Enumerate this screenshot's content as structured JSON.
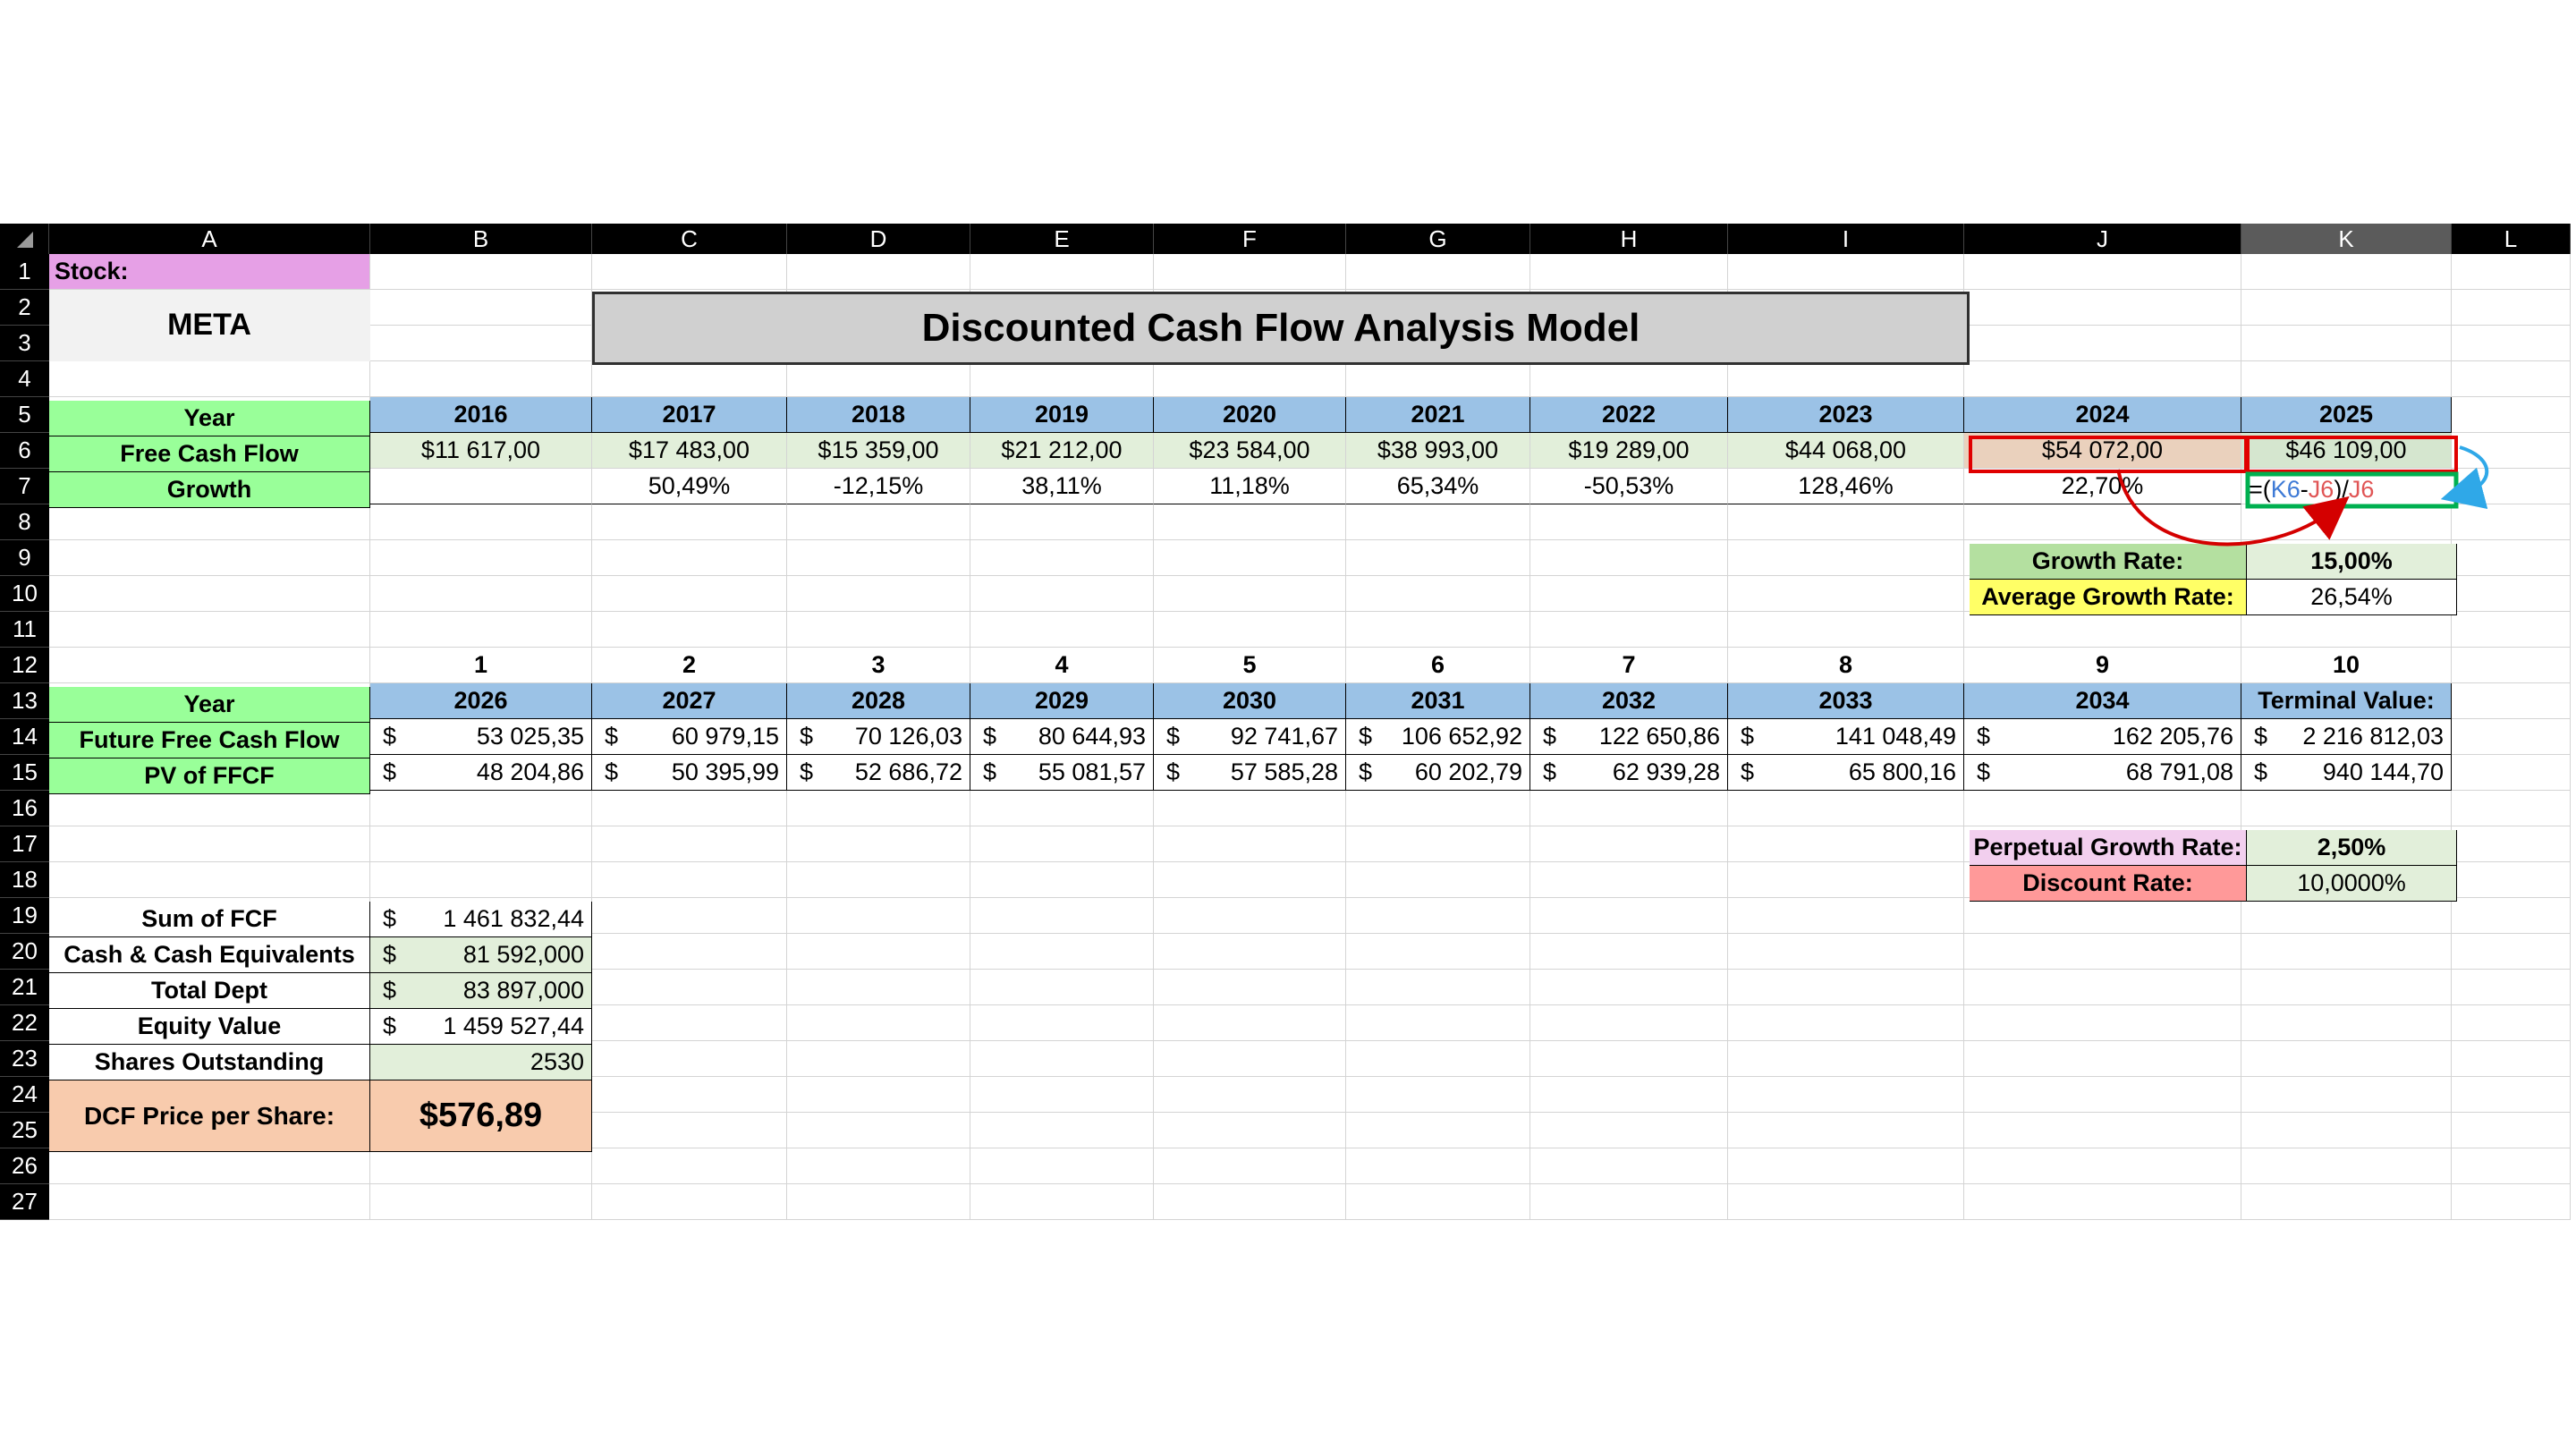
{
  "sheet": {
    "columns": [
      "A",
      "B",
      "C",
      "D",
      "E",
      "F",
      "G",
      "H",
      "I",
      "J",
      "K",
      "L"
    ],
    "selected_column": "K",
    "rows": [
      "1",
      "2",
      "3",
      "4",
      "5",
      "6",
      "7",
      "8",
      "9",
      "10",
      "11",
      "12",
      "13",
      "14",
      "15",
      "16",
      "17",
      "18",
      "19",
      "20",
      "21",
      "22",
      "23",
      "24",
      "25",
      "26",
      "27"
    ]
  },
  "stock": {
    "label": "Stock:",
    "ticker": "META"
  },
  "title": "Discounted Cash Flow Analysis Model",
  "historical": {
    "year_label": "Year",
    "years": [
      "2016",
      "2017",
      "2018",
      "2019",
      "2020",
      "2021",
      "2022",
      "2023",
      "2024",
      "2025"
    ],
    "fcf_label": "Free Cash Flow",
    "fcf": [
      "$11 617,00",
      "$17 483,00",
      "$15 359,00",
      "$21 212,00",
      "$23 584,00",
      "$38 993,00",
      "$19 289,00",
      "$44 068,00",
      "$54 072,00",
      "$46 109,00"
    ],
    "growth_label": "Growth",
    "growth": [
      "",
      "50,49%",
      "-12,15%",
      "38,11%",
      "11,18%",
      "65,34%",
      "-50,53%",
      "128,46%",
      "22,70%",
      ""
    ],
    "formula_parts": [
      "=(",
      "K6",
      "-",
      "J6",
      ")/",
      "J6"
    ]
  },
  "rates": {
    "growth_rate_label": "Growth Rate:",
    "growth_rate": "15,00%",
    "avg_growth_label": "Average Growth Rate:",
    "avg_growth": "26,54%",
    "perpetual_label": "Perpetual Growth Rate:",
    "perpetual": "2,50%",
    "discount_label": "Discount Rate:",
    "discount": "10,0000%"
  },
  "projection": {
    "period_numbers": [
      "1",
      "2",
      "3",
      "4",
      "5",
      "6",
      "7",
      "8",
      "9",
      "10"
    ],
    "year_label": "Year",
    "years": [
      "2026",
      "2027",
      "2028",
      "2029",
      "2030",
      "2031",
      "2032",
      "2033",
      "2034",
      "Terminal Value:"
    ],
    "ffcf_label": "Future Free Cash Flow",
    "ffcf": [
      "53 025,35",
      "60 979,15",
      "70 126,03",
      "80 644,93",
      "92 741,67",
      "106 652,92",
      "122 650,86",
      "141 048,49",
      "162 205,76",
      "2 216 812,03"
    ],
    "pv_label": "PV of FFCF",
    "pv": [
      "48 204,86",
      "50 395,99",
      "52 686,72",
      "55 081,57",
      "57 585,28",
      "60 202,79",
      "62 939,28",
      "65 800,16",
      "68 791,08",
      "940 144,70"
    ],
    "currency": "$"
  },
  "summary": {
    "sum_label": "Sum of FCF",
    "sum": "1 461 832,44",
    "cash_label": "Cash & Cash Equivalents",
    "cash": "81 592,000",
    "debt_label": "Total Dept",
    "debt": "83 897,000",
    "equity_label": "Equity Value",
    "equity": "1 459 527,44",
    "shares_label": "Shares Outstanding",
    "shares": "2530",
    "price_label": "DCF Price per Share:",
    "price": "$576,89",
    "currency": "$"
  },
  "colors": {
    "green_header": "#99ff99",
    "blue_header": "#9bc2e6",
    "light_green": "#e2efda",
    "pink": "#e6a0e6",
    "yellow": "#ffff66",
    "salmon": "#f8cbad",
    "red_label": "#ff9999",
    "purple_label": "#f2cfee",
    "highlight_red": "#e00000",
    "highlight_green": "#00b050",
    "arrow_blue": "#2fa8e8"
  }
}
